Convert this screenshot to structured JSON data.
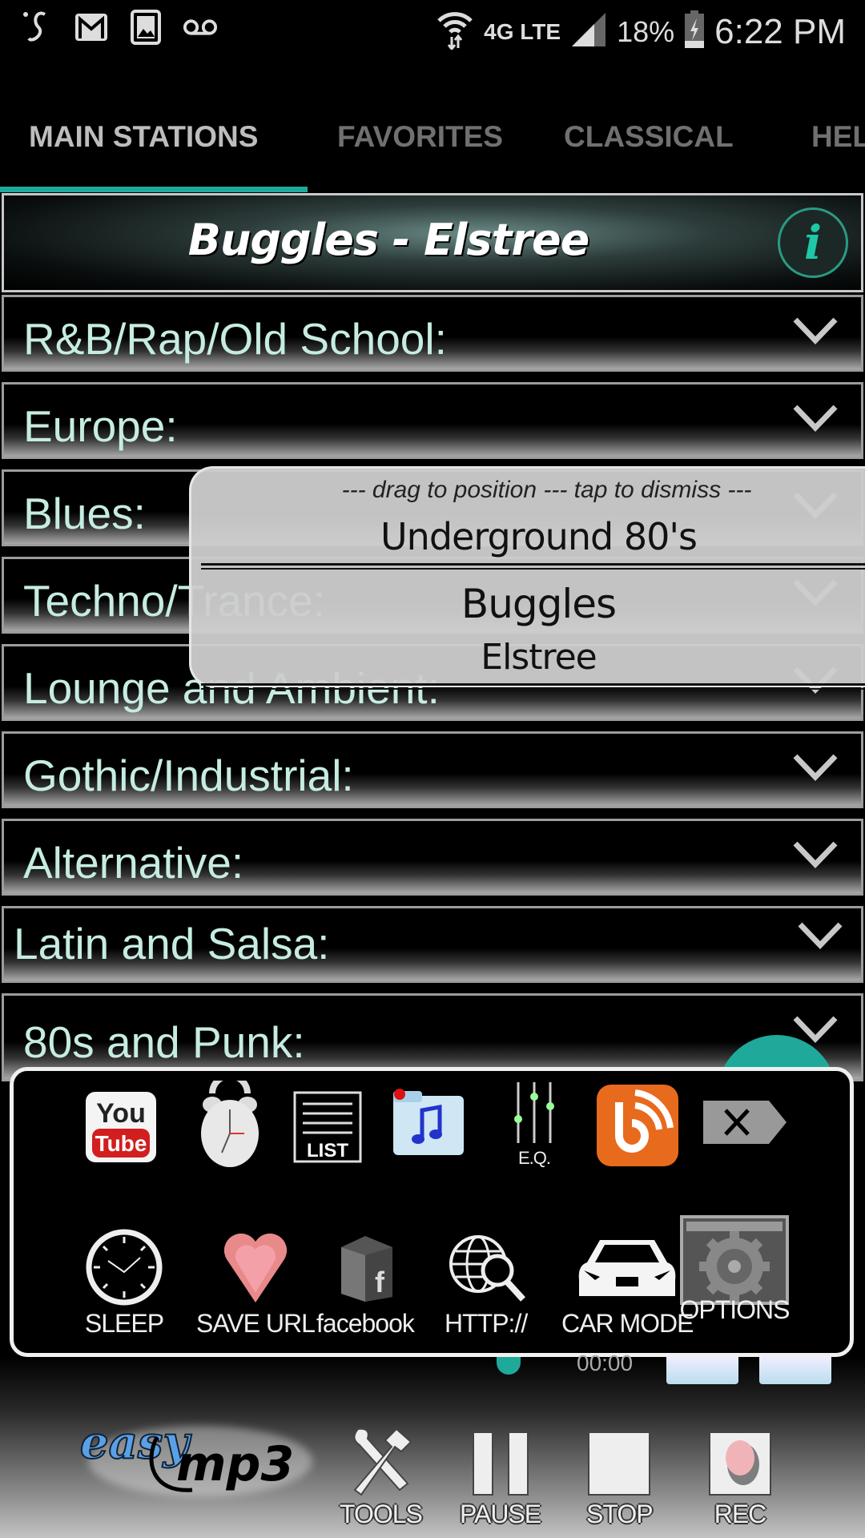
{
  "status_bar": {
    "left_icons": [
      "swype-icon",
      "gmail-icon",
      "gallery-icon",
      "voicemail-icon"
    ],
    "network": "4G LTE",
    "battery": "18%",
    "time": "6:22 PM"
  },
  "tabs": [
    {
      "label": "MAIN STATIONS",
      "active": true
    },
    {
      "label": "FAVORITES",
      "active": false
    },
    {
      "label": "CLASSICAL",
      "active": false
    },
    {
      "label": "HELP",
      "active": false
    }
  ],
  "now_playing": {
    "title": "Buggles - Elstree",
    "info_icon": "info-icon"
  },
  "categories": [
    {
      "label": "R&B/Rap/Old School:"
    },
    {
      "label": "Europe:"
    },
    {
      "label": "Blues:"
    },
    {
      "label": "Techno/Trance:"
    },
    {
      "label": "Lounge and Ambient:"
    },
    {
      "label": "Gothic/Industrial:"
    },
    {
      "label": "Alternative:"
    },
    {
      "label": "Latin and Salsa:"
    },
    {
      "label": "80s and Punk:"
    }
  ],
  "popup": {
    "hint": "--- drag to position --- tap to dismiss ---",
    "station": "Underground 80's",
    "artist": "Buggles",
    "song": "Elstree"
  },
  "tools_panel": {
    "row1": [
      {
        "name": "youtube",
        "label": ""
      },
      {
        "name": "alarm",
        "label": ""
      },
      {
        "name": "list",
        "label": "LIST"
      },
      {
        "name": "music-folder",
        "label": ""
      },
      {
        "name": "equalizer",
        "label": "E.Q."
      },
      {
        "name": "blog-feed",
        "label": ""
      },
      {
        "name": "close",
        "label": ""
      }
    ],
    "row2": [
      {
        "name": "sleep",
        "label": "SLEEP"
      },
      {
        "name": "save-url",
        "label": "SAVE URL"
      },
      {
        "name": "facebook",
        "label": "facebook"
      },
      {
        "name": "http",
        "label": "HTTP://"
      },
      {
        "name": "car-mode",
        "label": "CAR MODE"
      },
      {
        "name": "options",
        "label": "OPTIONS"
      }
    ]
  },
  "player": {
    "elapsed": "00:00",
    "logo_text_1": "easy",
    "logo_text_2": "mp3",
    "controls": [
      {
        "name": "tools",
        "label": "TOOLS"
      },
      {
        "name": "pause",
        "label": "PAUSE"
      },
      {
        "name": "stop",
        "label": "STOP"
      },
      {
        "name": "rec",
        "label": "REC"
      }
    ]
  },
  "colors": {
    "accent": "#1fa99a",
    "category_text": "#c6ece2",
    "info_icon": "#1ec7a6"
  }
}
